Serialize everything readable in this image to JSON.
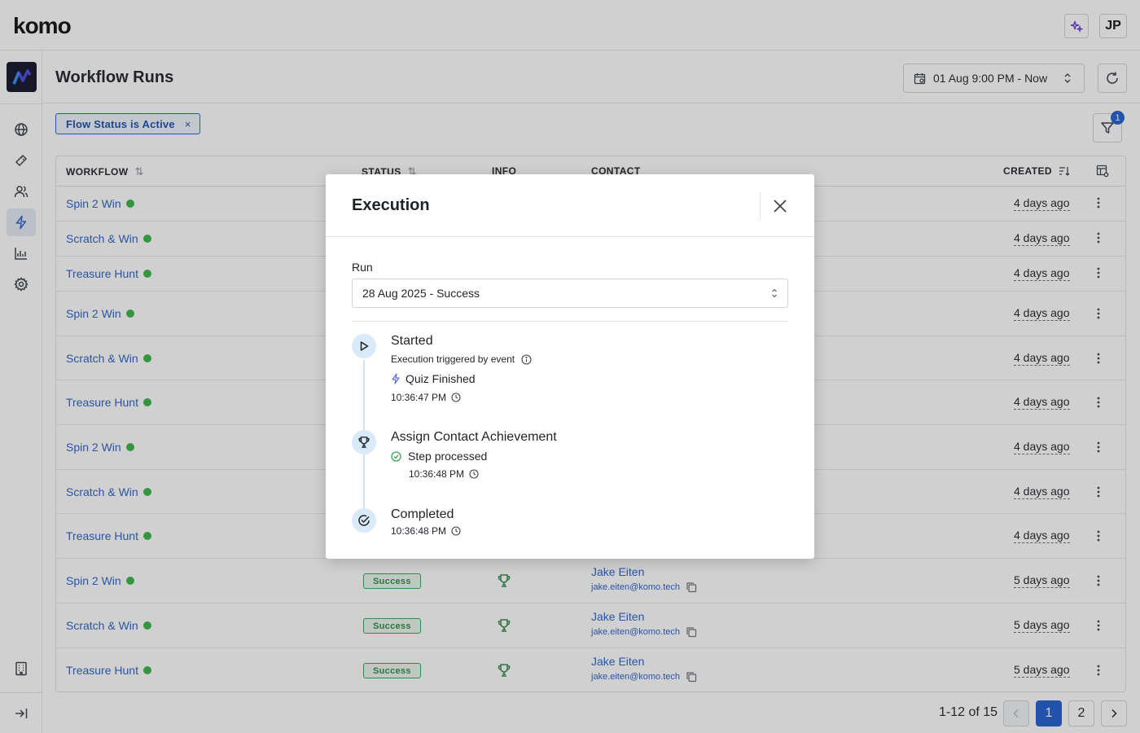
{
  "app": {
    "logo": "komo",
    "user_initials": "JP"
  },
  "header": {
    "title": "Workflow Runs",
    "date_range": "01 Aug 9:00 PM - Now"
  },
  "filters": {
    "chip_label": "Flow Status is Active",
    "chip_remove": "×",
    "active_count": "1"
  },
  "table": {
    "columns": {
      "workflow": "WORKFLOW",
      "status": "STATUS",
      "info": "INFO",
      "contact": "CONTACT",
      "created": "CREATED"
    },
    "rows": [
      {
        "workflow": "Spin 2 Win",
        "created": "4 days ago"
      },
      {
        "workflow": "Scratch & Win",
        "created": "4 days ago"
      },
      {
        "workflow": "Treasure Hunt",
        "created": "4 days ago"
      },
      {
        "workflow": "Spin 2 Win",
        "created": "4 days ago"
      },
      {
        "workflow": "Scratch & Win",
        "created": "4 days ago"
      },
      {
        "workflow": "Treasure Hunt",
        "created": "4 days ago"
      },
      {
        "workflow": "Spin 2 Win",
        "created": "4 days ago"
      },
      {
        "workflow": "Scratch & Win",
        "created": "4 days ago"
      },
      {
        "workflow": "Treasure Hunt",
        "created": "4 days ago"
      },
      {
        "workflow": "Spin 2 Win",
        "status": "Success",
        "contact_name": "Jake Eiten",
        "contact_email": "jake.eiten@komo.tech",
        "created": "5 days ago"
      },
      {
        "workflow": "Scratch & Win",
        "status": "Success",
        "contact_name": "Jake Eiten",
        "contact_email": "jake.eiten@komo.tech",
        "created": "5 days ago"
      },
      {
        "workflow": "Treasure Hunt",
        "status": "Success",
        "contact_name": "Jake Eiten",
        "contact_email": "jake.eiten@komo.tech",
        "created": "5 days ago"
      }
    ]
  },
  "pagination": {
    "range_label": "1-12 of 15",
    "pages": [
      "1",
      "2"
    ],
    "current_page": "1"
  },
  "modal": {
    "title": "Execution",
    "run_label": "Run",
    "run_value": "28 Aug 2025 - Success",
    "timeline": {
      "started": {
        "title": "Started",
        "subtitle": "Execution triggered by event",
        "event": "Quiz Finished",
        "time": "10:36:47 PM"
      },
      "assign": {
        "title": "Assign Contact Achievement",
        "status": "Step processed",
        "time": "10:36:48 PM"
      },
      "completed": {
        "title": "Completed",
        "time": "10:36:48 PM"
      }
    }
  },
  "colors": {
    "accent": "#1f5fd1",
    "link": "#2a62c9",
    "success": "#2e8a47",
    "active_dot": "#39b54a"
  }
}
